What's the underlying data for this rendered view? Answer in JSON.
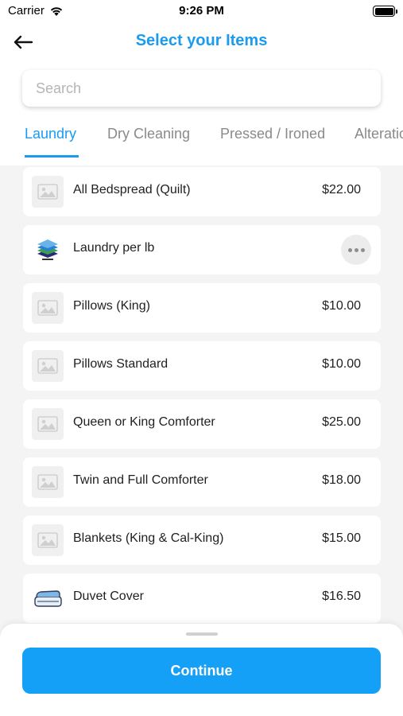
{
  "status_bar": {
    "carrier": "Carrier",
    "time": "9:26 PM"
  },
  "header": {
    "title": "Select your Items",
    "back_icon": "arrow-left-icon"
  },
  "search": {
    "placeholder": "Search",
    "value": ""
  },
  "tabs": [
    {
      "label": "Laundry",
      "active": true
    },
    {
      "label": "Dry Cleaning",
      "active": false
    },
    {
      "label": "Pressed / Ironed",
      "active": false
    },
    {
      "label": "Alteratio",
      "active": false
    }
  ],
  "items": [
    {
      "name": "All Bedspread (Quilt)",
      "price": "$22.00",
      "icon": "image-placeholder-icon"
    },
    {
      "name": "Laundry per lb",
      "price": "",
      "icon": "clothes-stack-icon",
      "has_more_menu": true
    },
    {
      "name": "Pillows (King)",
      "price": "$10.00",
      "icon": "image-placeholder-icon"
    },
    {
      "name": "Pillows Standard",
      "price": "$10.00",
      "icon": "image-placeholder-icon"
    },
    {
      "name": "Queen or King Comforter",
      "price": "$25.00",
      "icon": "image-placeholder-icon"
    },
    {
      "name": "Twin and Full Comforter",
      "price": "$18.00",
      "icon": "image-placeholder-icon"
    },
    {
      "name": "Blankets (King & Cal-King)",
      "price": "$15.00",
      "icon": "image-placeholder-icon"
    },
    {
      "name": "Duvet Cover",
      "price": "$16.50",
      "icon": "folded-blanket-icon"
    }
  ],
  "footer": {
    "continue_label": "Continue"
  },
  "colors": {
    "accent": "#1a9bf0",
    "button": "#14a0f7",
    "background": "#f4f4f4"
  }
}
